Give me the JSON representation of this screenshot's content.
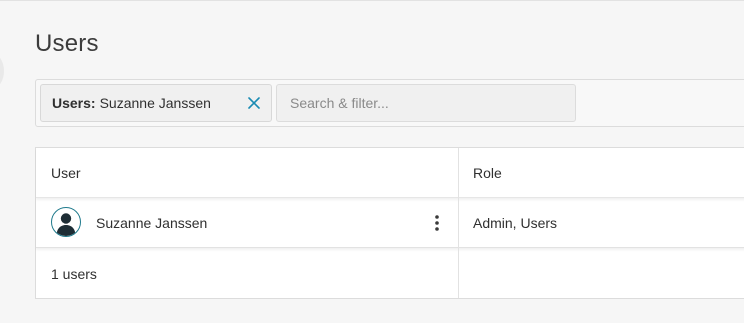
{
  "page": {
    "title": "Users"
  },
  "filter": {
    "chip_key": "Users:",
    "chip_value": "Suzanne Janssen",
    "search_placeholder": "Search & filter..."
  },
  "table": {
    "columns": [
      "User",
      "Role"
    ],
    "rows": [
      {
        "user": "Suzanne Janssen",
        "role": "Admin, Users"
      }
    ],
    "footer_count": "1 users"
  },
  "icons": {
    "chip_close": "close-icon",
    "avatar": "user-avatar-icon",
    "row_menu": "kebab-menu-icon"
  },
  "colors": {
    "accent": "#1a8bb3",
    "avatar_ring": "#1f7a8c",
    "avatar_figure": "#1d2d35"
  }
}
